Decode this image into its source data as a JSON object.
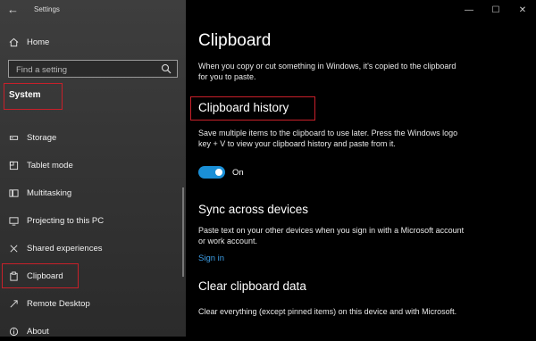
{
  "window": {
    "title": "Settings",
    "minimize_glyph": "—",
    "maximize_glyph": "☐",
    "close_glyph": "✕",
    "back_glyph": "←"
  },
  "sidebar": {
    "home_label": "Home",
    "search_placeholder": "Find a setting",
    "section_title": "System",
    "items": [
      {
        "label": "Storage",
        "icon": "storage-icon"
      },
      {
        "label": "Tablet mode",
        "icon": "tablet-mode-icon"
      },
      {
        "label": "Multitasking",
        "icon": "multitasking-icon"
      },
      {
        "label": "Projecting to this PC",
        "icon": "projecting-icon"
      },
      {
        "label": "Shared experiences",
        "icon": "shared-experiences-icon"
      },
      {
        "label": "Clipboard",
        "icon": "clipboard-icon",
        "selected": true
      },
      {
        "label": "Remote Desktop",
        "icon": "remote-desktop-icon"
      },
      {
        "label": "About",
        "icon": "info-icon"
      }
    ]
  },
  "main": {
    "title": "Clipboard",
    "intro": "When you copy or cut something in Windows, it's copied to the clipboard for you to paste.",
    "history": {
      "heading": "Clipboard history",
      "description": "Save multiple items to the clipboard to use later. Press the Windows logo key + V to view your clipboard history and paste from it.",
      "toggle_state": "On"
    },
    "sync": {
      "heading": "Sync across devices",
      "description": "Paste text on your other devices when you sign in with a Microsoft account or work account.",
      "link": "Sign in"
    },
    "clear": {
      "heading": "Clear clipboard data",
      "description": "Clear everything (except pinned items) on this device and with Microsoft."
    }
  },
  "colors": {
    "accent": "#1a8fd6",
    "link": "#3d9ee6",
    "highlight_box": "#c8202a"
  }
}
